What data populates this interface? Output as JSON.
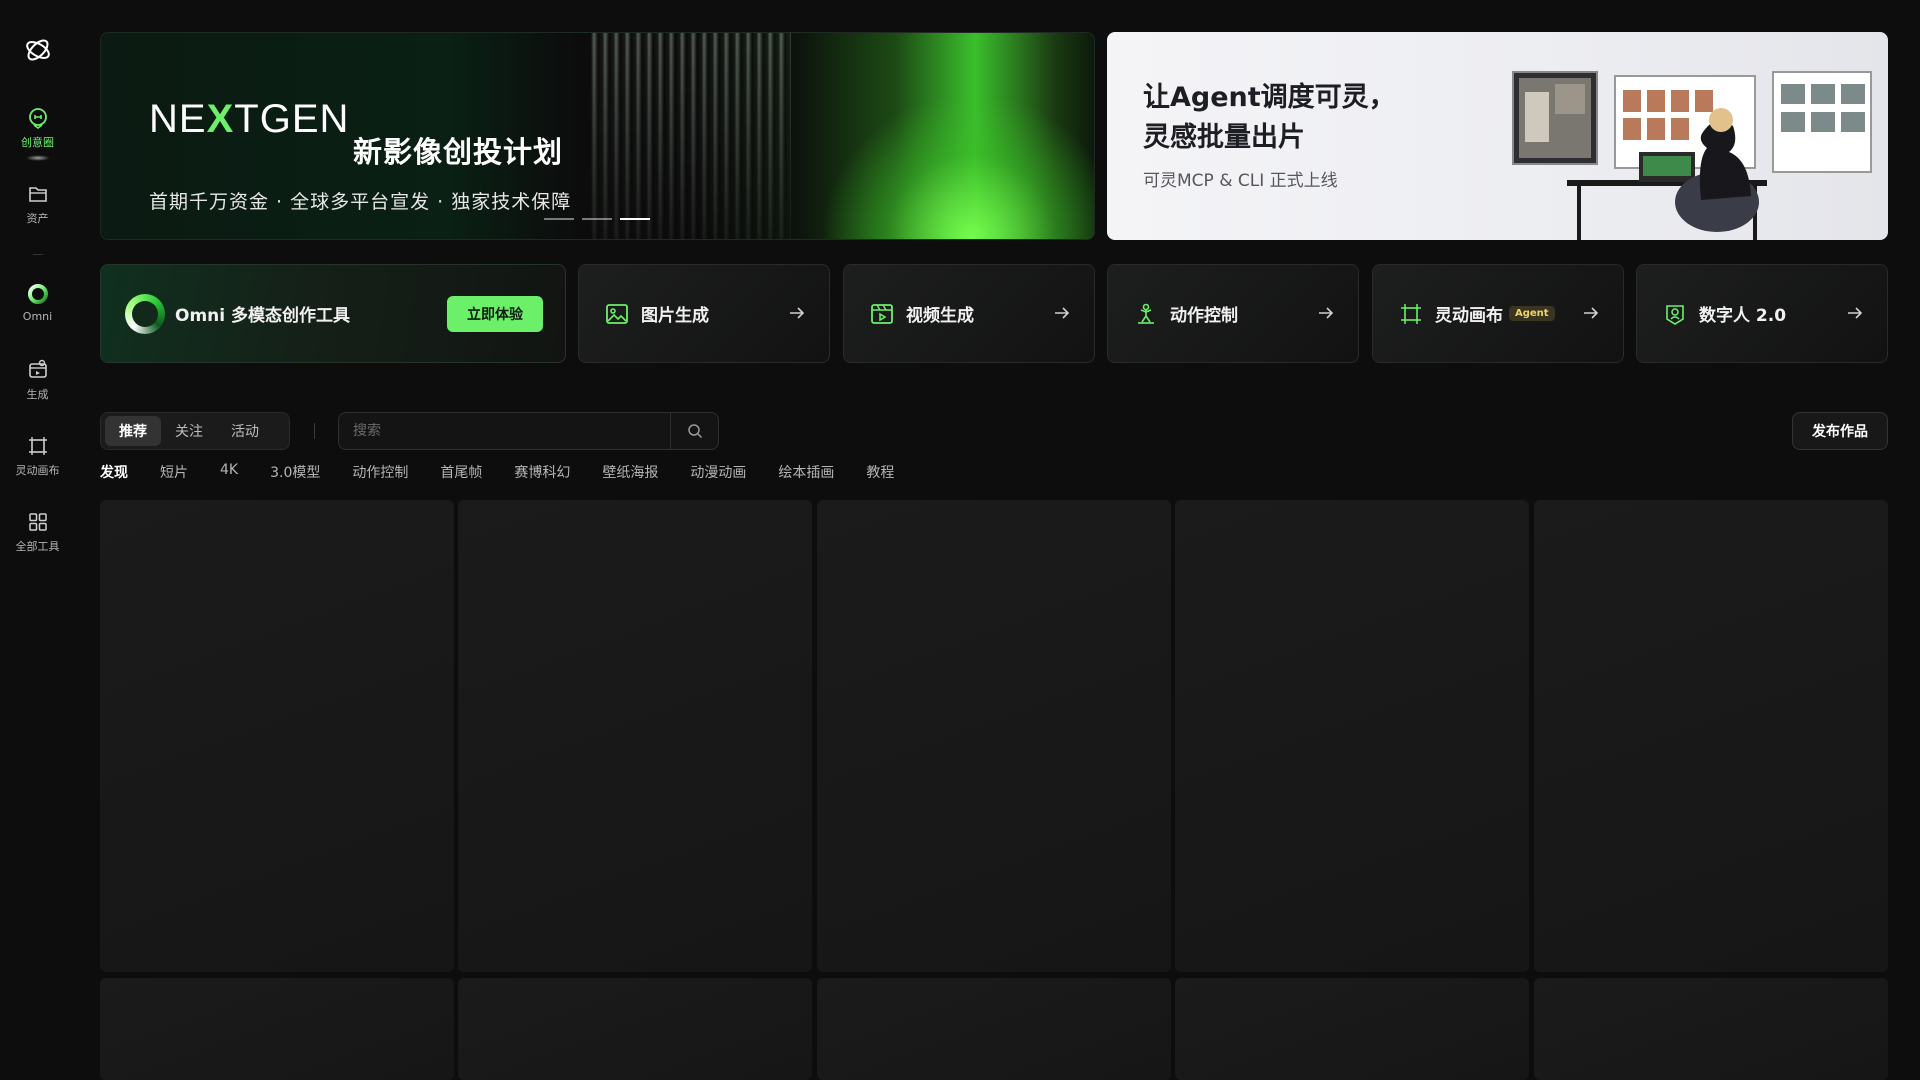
{
  "sidebar": {
    "items": [
      {
        "label": "创意圈",
        "icon": "creative-circle-icon"
      },
      {
        "label": "资产",
        "icon": "folder-icon"
      },
      {
        "label": "Omni",
        "icon": "omni-icon"
      },
      {
        "label": "生成",
        "icon": "generate-icon"
      },
      {
        "label": "灵动画布",
        "icon": "canvas-icon"
      },
      {
        "label": "全部工具",
        "icon": "grid-icon"
      }
    ]
  },
  "banners": {
    "left": {
      "brand_pre": "NE",
      "brand_x": "X",
      "brand_post": "TGEN",
      "title": "新影像创投计划",
      "subtitle": "首期千万资金 · 全球多平台宣发 · 独家技术保障"
    },
    "right": {
      "title_line1": "让Agent调度可灵，",
      "title_line2": "灵感批量出片",
      "subtitle": "可灵MCP & CLI 正式上线"
    }
  },
  "tools": {
    "omni": {
      "label": "Omni 多模态创作工具",
      "cta": "立即体验"
    },
    "image": {
      "label": "图片生成"
    },
    "video": {
      "label": "视频生成"
    },
    "motion": {
      "label": "动作控制"
    },
    "canvas": {
      "label": "灵动画布",
      "badge": "Agent"
    },
    "avatar": {
      "label": "数字人 2.0"
    }
  },
  "feed": {
    "tabs": [
      "推荐",
      "关注",
      "活动"
    ],
    "search_placeholder": "搜索",
    "publish_label": "发布作品",
    "categories": [
      "发现",
      "短片",
      "4K",
      "3.0模型",
      "动作控制",
      "首尾帧",
      "赛博科幻",
      "壁纸海报",
      "动漫动画",
      "绘本插画",
      "教程"
    ]
  },
  "colors": {
    "accent": "#6cf06a",
    "background": "#0d0d0d"
  }
}
